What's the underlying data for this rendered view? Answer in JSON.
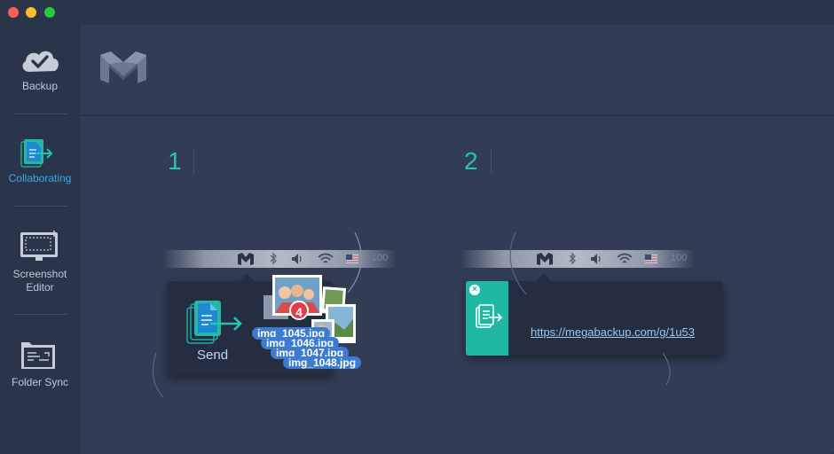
{
  "window": {
    "controls": [
      "close",
      "minimize",
      "zoom"
    ]
  },
  "sidebar": {
    "items": [
      {
        "label": "Backup",
        "icon": "cloud-check-icon",
        "active": false
      },
      {
        "label": "Collaborating",
        "icon": "send-files-icon",
        "active": true
      },
      {
        "label": "Screenshot\nEditor",
        "label_line1": "Screenshot",
        "label_line2": "Editor",
        "icon": "screenshot-icon",
        "active": false
      },
      {
        "label": "Folder Sync",
        "icon": "folder-sync-icon",
        "active": false
      }
    ]
  },
  "main": {
    "logo_icon": "megabackup-logo-icon",
    "steps": [
      {
        "number": "1",
        "menubar": {
          "battery_text": "100"
        },
        "popup": {
          "send_label": "Send",
          "badge_count": "4",
          "files": [
            "img_1045.jpg",
            "img_1046.jpg",
            "img_1047.jpg",
            "img_1048.jpg"
          ]
        }
      },
      {
        "number": "2",
        "menubar": {
          "battery_text": "100"
        },
        "popup": {
          "link": "https://megabackup.com/g/1u53"
        }
      }
    ]
  },
  "colors": {
    "accent_teal": "#1fb9a3",
    "active_blue": "#39a8f1",
    "background": "#323d55",
    "sidebar": "#2b3549"
  }
}
